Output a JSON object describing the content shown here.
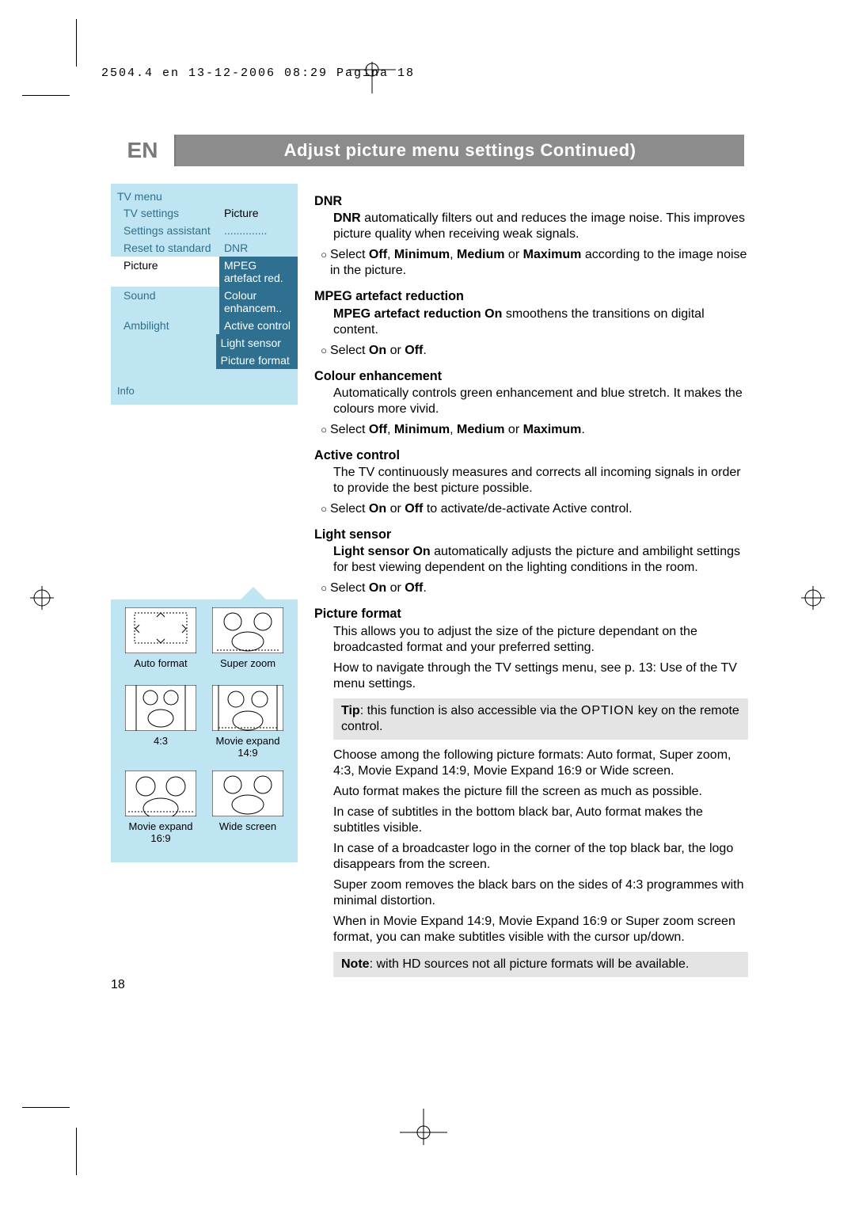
{
  "meta_line": "2504.4 en  13-12-2006  08:29  Pagina 18",
  "title_lang": "EN",
  "title_text": "Adjust picture menu settings  Continued)",
  "tv_menu": {
    "title": "TV menu",
    "left": [
      "TV settings",
      "Settings assistant",
      "Reset to standard",
      "Picture",
      "Sound",
      "Ambilight"
    ],
    "right": [
      "Picture",
      "..............",
      "DNR",
      "MPEG artefact red.",
      "Colour enhancem..",
      "Active control",
      "Light sensor",
      "Picture format"
    ],
    "info": "Info"
  },
  "sections": {
    "dnr": {
      "head": "DNR",
      "p1a": "DNR",
      "p1b": " automatically filters out and reduces the image noise. This improves picture quality when receiving weak signals.",
      "b1a": "Select ",
      "b1b": "Off",
      "b1c": ", ",
      "b1d": "Minimum",
      "b1e": ", ",
      "b1f": "Medium",
      "b1g": " or ",
      "b1h": "Maximum",
      "b1i": " according to the image noise in the picture."
    },
    "mpeg": {
      "head": "MPEG artefact reduction",
      "p1a": "MPEG artefact reduction On",
      "p1b": " smoothens the transitions on digital content.",
      "b1a": "Select ",
      "b1b": "On",
      "b1c": " or ",
      "b1d": "Off",
      "b1e": "."
    },
    "colour": {
      "head": "Colour enhancement",
      "p1": "Automatically controls green enhancement and blue stretch. It makes the colours more vivid.",
      "b1a": "Select ",
      "b1b": "Off",
      "b1c": ", ",
      "b1d": "Minimum",
      "b1e": ", ",
      "b1f": "Medium",
      "b1g": " or ",
      "b1h": "Maximum",
      "b1i": "."
    },
    "active": {
      "head": "Active control",
      "p1": "The TV continuously measures and corrects all incoming signals in order to provide the best picture possible.",
      "b1a": "Select ",
      "b1b": "On",
      "b1c": " or ",
      "b1d": "Off",
      "b1e": " to activate/de-activate Active control."
    },
    "light": {
      "head": "Light sensor",
      "p1a": "Light sensor On",
      "p1b": " automatically adjusts the picture and ambilight settings for best viewing dependent on the lighting conditions in the room.",
      "b1a": "Select ",
      "b1b": "On",
      "b1c": " or ",
      "b1d": "Off",
      "b1e": "."
    },
    "pf": {
      "head": "Picture format",
      "p1": "This allows you to adjust the size of the picture dependant on the broadcasted format and your preferred setting.",
      "p2": "How to navigate through the TV settings menu, see p. 13: Use of the TV menu settings.",
      "tip_a": "Tip",
      "tip_b": ": this function is also accessible via the ",
      "tip_c": "OPTION",
      "tip_d": " key on the remote control.",
      "p3": "Choose among the following picture formats: Auto format, Super zoom, 4:3, Movie Expand 14:9, Movie Expand 16:9 or Wide screen.",
      "p4": "Auto format makes the picture fill the screen as much as possible.",
      "p5": "In case of subtitles in the bottom black bar, Auto format makes the subtitles visible.",
      "p6": "In case of a broadcaster logo in the corner of the top black bar, the logo disappears from the screen.",
      "p7": "Super zoom removes the black bars on the sides of 4:3 programmes with minimal distortion.",
      "p8": "When in Movie Expand 14:9, Movie Expand 16:9 or Super zoom screen format, you can make subtitles visible with the cursor up/down.",
      "note_a": "Note",
      "note_b": ": with HD sources not all picture formats will be available."
    }
  },
  "pf_labels": {
    "auto": "Auto format",
    "superzoom": "Super zoom",
    "r43": "4:3",
    "me149": "Movie expand 14:9",
    "me169": "Movie expand 16:9",
    "wide": "Wide screen"
  },
  "page_number": "18"
}
